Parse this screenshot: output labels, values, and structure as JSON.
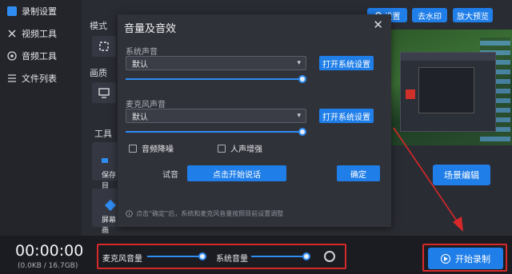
{
  "sidebar": {
    "items": [
      {
        "label": "录制设置",
        "icon": "record-icon",
        "active": true
      },
      {
        "label": "视频工具",
        "icon": "tools-icon",
        "active": false
      },
      {
        "label": "音频工具",
        "icon": "audio-icon",
        "active": false
      },
      {
        "label": "文件列表",
        "icon": "list-icon",
        "active": false
      }
    ]
  },
  "main": {
    "mode_label": "模式",
    "quality_label": "画质",
    "tools_label": "工具",
    "tool_tiles": [
      {
        "label": "保存目"
      },
      {
        "label": "屏幕画"
      }
    ]
  },
  "top_buttons": {
    "settings": "设置",
    "watermark": "去水印",
    "magnify_preview": "放大预览"
  },
  "scene_edit_label": "场景编辑",
  "dialog": {
    "title": "音量及音效",
    "close": "✕",
    "system_sound_label": "系统声音",
    "system_sound_value": "默认",
    "system_sound_level": 1.0,
    "open_system_settings_1": "打开系统设置",
    "mic_sound_label": "麦克风声音",
    "mic_sound_value": "默认",
    "mic_sound_level": 1.0,
    "open_system_settings_2": "打开系统设置",
    "noise_reduction_label": "音频降噪",
    "noise_reduction_checked": false,
    "voice_enhance_label": "人声增强",
    "voice_enhance_checked": false,
    "test_label": "试音",
    "test_button": "点击开始说话",
    "ok_button": "确定",
    "hint": "点击“确定”后，系统和麦克风音量按照目前设置调整"
  },
  "bottom": {
    "timer": "00:00:00",
    "file_size": "(0.0KB / 16.7GB)",
    "mic_volume_label": "麦克风音量",
    "mic_volume_level": 1.0,
    "system_volume_label": "系统音量",
    "system_volume_level": 1.0,
    "start_record_label": "开始录制"
  },
  "colors": {
    "accent": "#1f7ee8",
    "highlight_border": "#d8282a"
  }
}
